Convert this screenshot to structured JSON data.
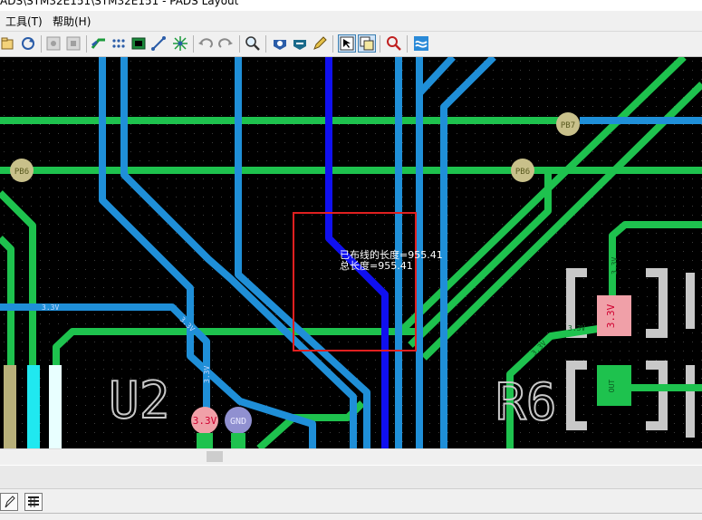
{
  "window": {
    "title": "ADS\\STM32E151\\STM32E151 - PADS Layout"
  },
  "menu": {
    "tools": "工具(T)",
    "help": "帮助(H)"
  },
  "toolbar": {
    "icons": [
      "open-icon",
      "refresh-icon",
      "layer-a-icon",
      "layer-b-icon",
      "route-icon",
      "autoroute-icon",
      "board-icon",
      "diagonal-icon",
      "starburst-icon",
      "undo-icon",
      "redo-icon",
      "zoom-icon",
      "view-a-icon",
      "view-b-icon",
      "pen-icon",
      "select-mode-icon",
      "stack-icon",
      "verify-icon",
      "wave-icon"
    ]
  },
  "pcb": {
    "nets": {
      "pb6_left": "PB6",
      "pb6_right": "PB6",
      "pb7": "PB7",
      "v33_a": "3.3V",
      "v33_b": "3.3V",
      "v33_c": "3.3V",
      "v33_d": "3.3V",
      "v33_e": "3.3V",
      "v33_f": "3.3V"
    },
    "pads": {
      "v33": "3.3V",
      "gnd": "GND",
      "pad_33": "3.3V",
      "pad_out": "OUT"
    },
    "refdes": {
      "u2": "U2",
      "r6": "R6"
    },
    "length_info": {
      "routed_length": "已布线的长度=955.41",
      "total_length": "总长度=955.41"
    },
    "colors": {
      "background": "#000000",
      "top_copper": "#1f8fd8",
      "bottom_copper": "#1ec24e",
      "highlighted_trace": "#1010f0",
      "silkscreen": "#c8c8c8",
      "selection_box": "#e02020",
      "pad_label": "#c8c08a"
    }
  }
}
